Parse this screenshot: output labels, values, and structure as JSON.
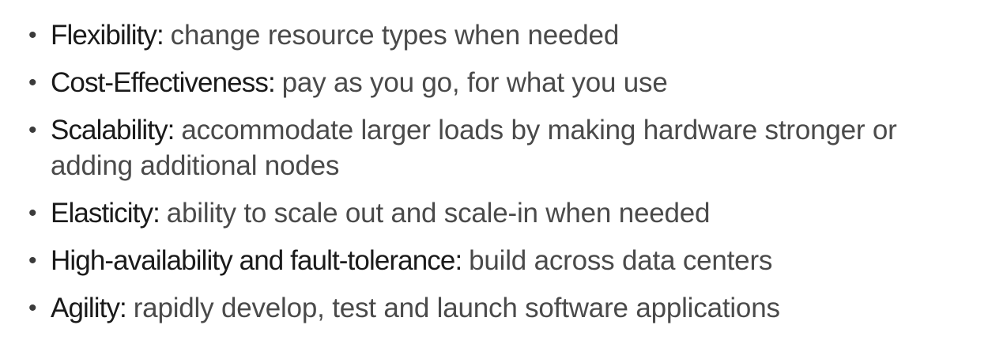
{
  "bullets": [
    {
      "term": "Flexibility:",
      "description": "change resource types when needed"
    },
    {
      "term": "Cost-Effectiveness:",
      "description": "pay as you go, for what you use"
    },
    {
      "term": "Scalability:",
      "description": "accommodate larger loads by making hardware stronger or adding additional nodes"
    },
    {
      "term": "Elasticity:",
      "description": "ability to scale out and scale-in when needed"
    },
    {
      "term": "High-availability and fault-tolerance:",
      "description": "build across data centers"
    },
    {
      "term": "Agility:",
      "description": "rapidly develop, test and launch software applications"
    }
  ],
  "bullet_glyph": "•"
}
